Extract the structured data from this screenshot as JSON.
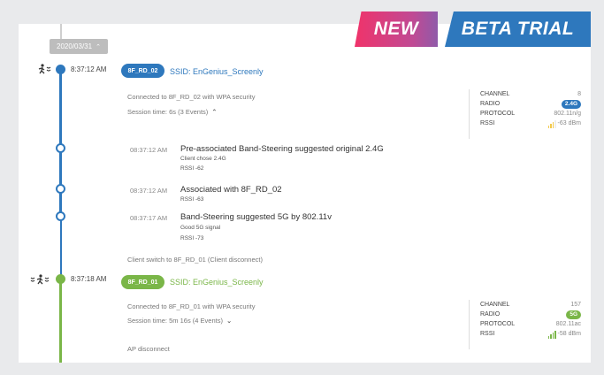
{
  "badges": {
    "new": "NEW",
    "beta": "BETA TRIAL"
  },
  "date_chip": {
    "label": "2020/03/31",
    "chevron": "^"
  },
  "colors": {
    "blue": "#2e78bd",
    "green": "#7ab648",
    "signal_weak": "#f2c94c"
  },
  "sessions": [
    {
      "time": "8:37:12 AM",
      "icons": "🏃≈",
      "ap_name": "8F_RD_02",
      "ssid_text": "SSID: EnGenius_Screenly",
      "security": "Connected to 8F_RD_02 with WPA security",
      "session_time": "Session time: 6s (3 Events)",
      "toggle": "^",
      "stats": {
        "channel_label": "CHANNEL",
        "channel": "8",
        "radio_label": "RADIO",
        "radio": "2.4G",
        "protocol_label": "PROTOCOL",
        "protocol": "802.11n/g",
        "rssi_label": "RSSI",
        "rssi": "-63 dBm"
      }
    },
    {
      "time": "8:37:18 AM",
      "icons": "≈🏃≈",
      "ap_name": "8F_RD_01",
      "ssid_text": "SSID: EnGenius_Screenly",
      "security": "Connected to 8F_RD_01 with WPA security",
      "session_time": "Session time: 5m 16s (4 Events)",
      "toggle": "v",
      "stats": {
        "channel_label": "CHANNEL",
        "channel": "157",
        "radio_label": "RADIO",
        "radio": "5G",
        "protocol_label": "PROTOCOL",
        "protocol": "802.11ac",
        "rssi_label": "RSSI",
        "rssi": "-58 dBm"
      }
    }
  ],
  "events": [
    {
      "time": "08:37:12 AM",
      "title": "Pre-associated Band-Steering suggested original 2.4G",
      "line1": "Client chose 2.4G",
      "line2": "RSSI -62"
    },
    {
      "time": "08:37:12 AM",
      "title": "Associated with 8F_RD_02",
      "line1": "RSSI -63",
      "line2": ""
    },
    {
      "time": "08:37:17 AM",
      "title": "Band-Steering suggested 5G by 802.11v",
      "line1": "Good 5G signal",
      "line2": "RSSI -73"
    }
  ],
  "switch_note": "Client switch to 8F_RD_01 (Client disconnect)",
  "ap_disconnect": "AP disconnect"
}
